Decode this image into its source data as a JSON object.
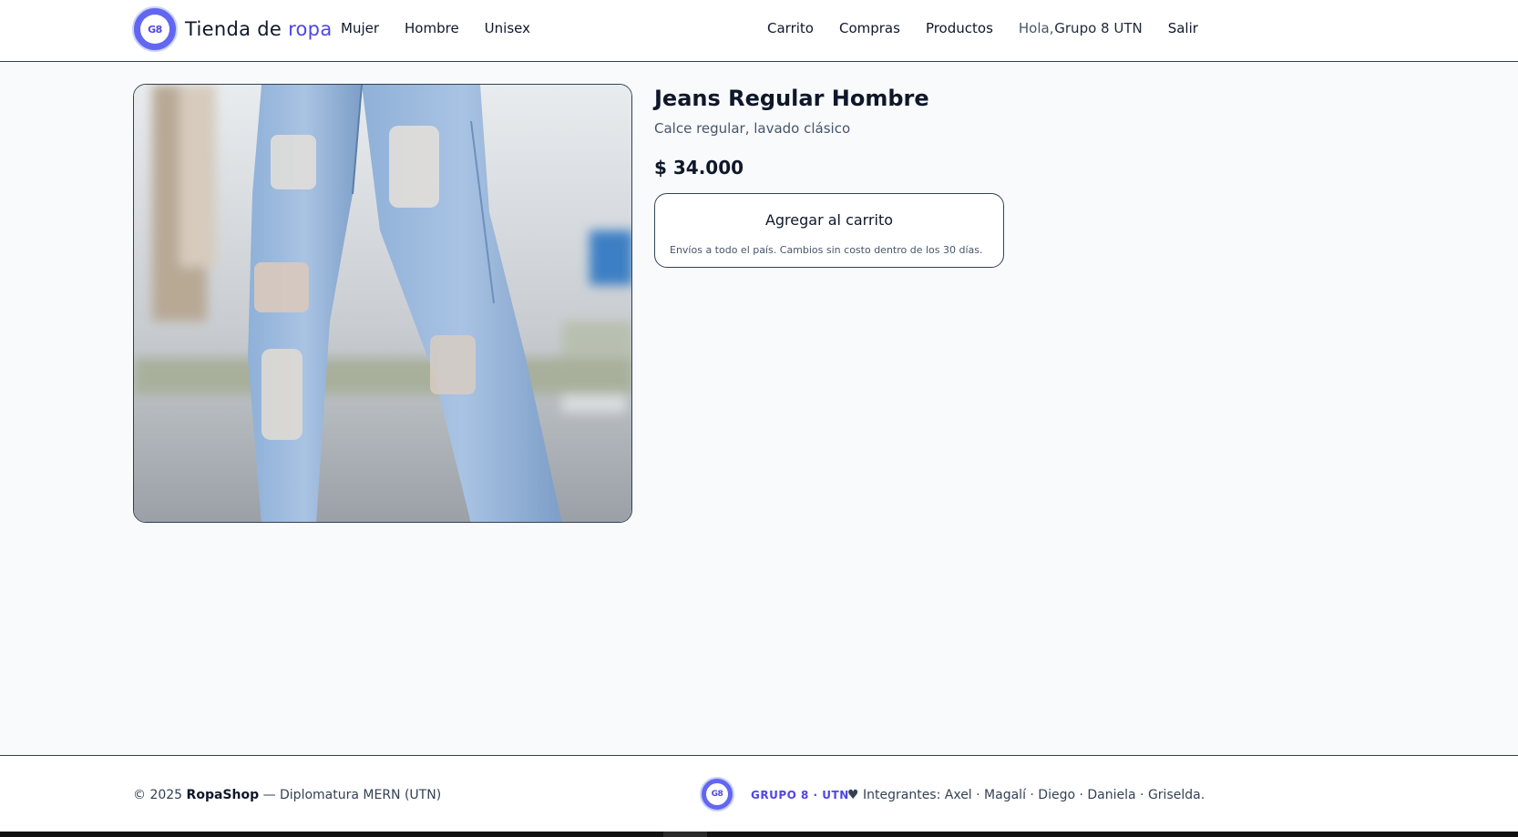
{
  "header": {
    "logo_text": "G8",
    "brand_prefix": "Tienda de",
    "brand_accent": "ropa",
    "nav_left": [
      "Mujer",
      "Hombre",
      "Unisex"
    ],
    "nav_right": [
      "Carrito",
      "Compras",
      "Productos"
    ],
    "greeting": "Hola,",
    "user_name": "Grupo 8 UTN",
    "logout": "Salir"
  },
  "product": {
    "title": "Jeans Regular Hombre",
    "description": "Calce regular, lavado clásico",
    "price": "$ 34.000",
    "add_to_cart": "Agregar al carrito",
    "shipping_note": "Envíos a todo el país. Cambios sin costo dentro de los 30 días."
  },
  "footer": {
    "copyright_prefix": "© 2025",
    "shop_name": "RopaShop",
    "copyright_suffix": "— Diplomatura MERN (UTN)",
    "logo_text": "G8",
    "group_label": "GRUPO 8 · UTN",
    "members": "♥ Integrantes: Axel · Magalí · Diego · Daniela · Griselda."
  },
  "colors": {
    "accent": "#4f46e5",
    "background": "#f8fafc",
    "text": "#0f172a"
  }
}
